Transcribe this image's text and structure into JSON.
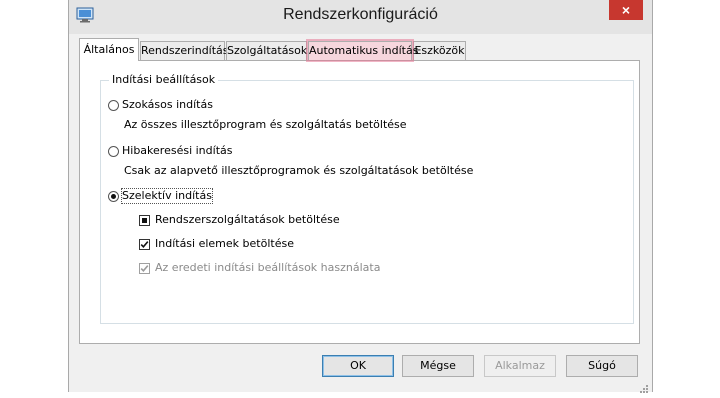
{
  "window": {
    "title": "Rendszerkonfiguráció",
    "close_glyph": "×"
  },
  "tabs": [
    {
      "label": "Általános",
      "selected": true
    },
    {
      "label": "Rendszerindítás"
    },
    {
      "label": "Szolgáltatások"
    },
    {
      "label": "Automatikus indítás",
      "highlighted": true
    },
    {
      "label": "Eszközök"
    }
  ],
  "startup_group": {
    "label": "Indítási beállítások",
    "normal": {
      "label": "Szokásos indítás",
      "desc": "Az összes illesztőprogram és szolgáltatás betöltése",
      "checked": false
    },
    "diagnostic": {
      "label": "Hibakeresési indítás",
      "desc": "Csak az alapvető illesztőprogramok és szolgáltatások betöltése",
      "checked": false
    },
    "selective": {
      "label": "Szelektív indítás",
      "checked": true
    },
    "load_system_services": {
      "label": "Rendszerszolgáltatások betöltése",
      "state": "indeterminate"
    },
    "load_startup_items": {
      "label": "Indítási elemek betöltése",
      "state": "checked"
    },
    "use_original_boot": {
      "label": "Az eredeti indítási beállítások használata",
      "state": "checked",
      "disabled": true
    }
  },
  "buttons": {
    "ok": "OK",
    "cancel": "Mégse",
    "apply": "Alkalmaz",
    "help": "Súgó"
  },
  "colors": {
    "close_red": "#c7372f",
    "tab_highlight": "#e6789a"
  }
}
